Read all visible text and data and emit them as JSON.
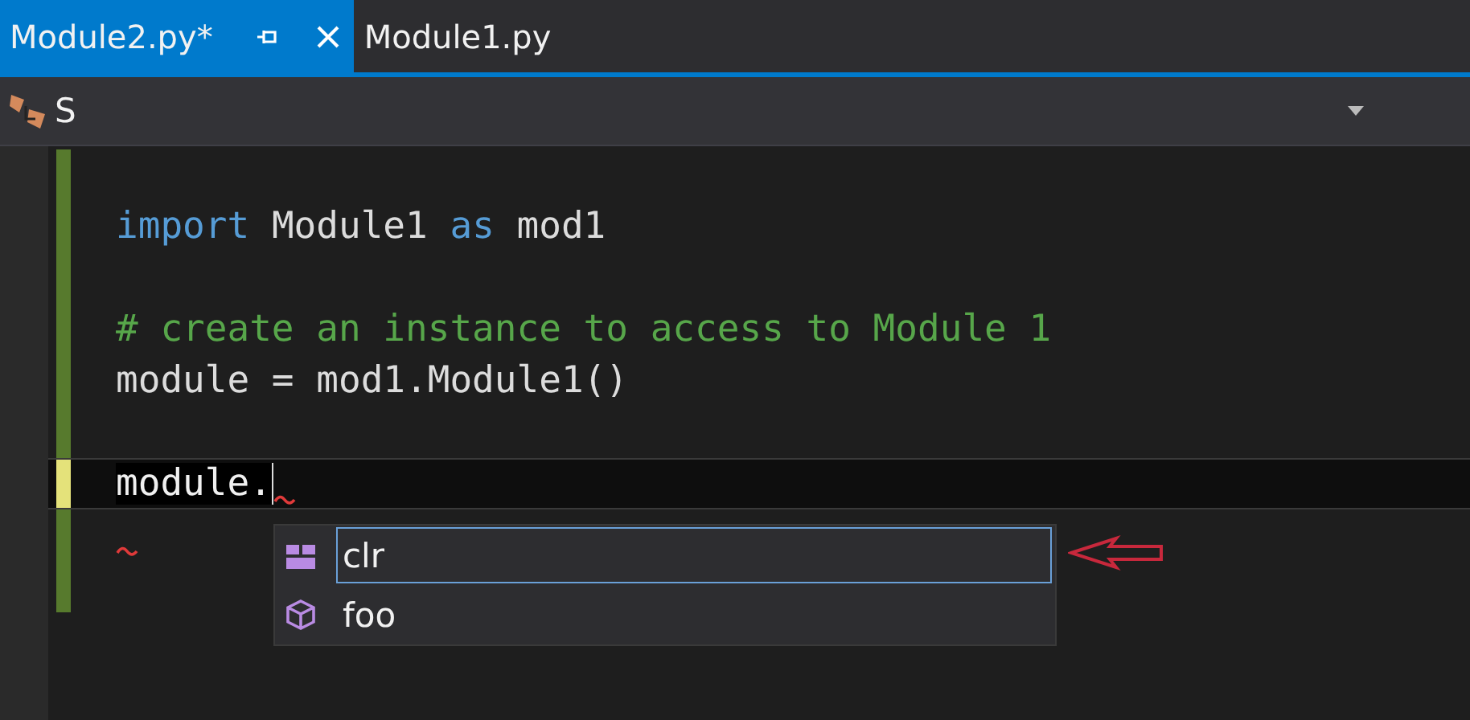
{
  "tabs": [
    {
      "label": "Module2.py*",
      "selected": true
    },
    {
      "label": "Module1.py",
      "selected": false
    }
  ],
  "navigation_bar": {
    "scope": "S"
  },
  "editor": {
    "lines": [
      {
        "unsaved": false
      },
      {
        "unsaved": false,
        "tokens": [
          {
            "kind": "keyword",
            "text": "import"
          },
          {
            "kind": "plain",
            "text": " Module1 "
          },
          {
            "kind": "keyword",
            "text": "as"
          },
          {
            "kind": "plain",
            "text": " mod1"
          }
        ]
      },
      {
        "unsaved": false
      },
      {
        "unsaved": false,
        "tokens": [
          {
            "kind": "comment",
            "text": "# create an instance to access to Module 1"
          }
        ]
      },
      {
        "unsaved": false,
        "tokens": [
          {
            "kind": "plain",
            "text": "module = mod1.Module1()"
          }
        ]
      },
      {
        "unsaved": false
      },
      {
        "unsaved": true,
        "current": true,
        "squiggle": true,
        "tokens": [
          {
            "kind": "selected",
            "text": "module."
          }
        ]
      },
      {
        "unsaved": false,
        "squiggle": true
      },
      {
        "unsaved": false
      }
    ]
  },
  "completion": {
    "items": [
      {
        "kind": "field",
        "label": "clr",
        "selected": true
      },
      {
        "kind": "class",
        "label": "foo",
        "selected": false
      }
    ]
  }
}
